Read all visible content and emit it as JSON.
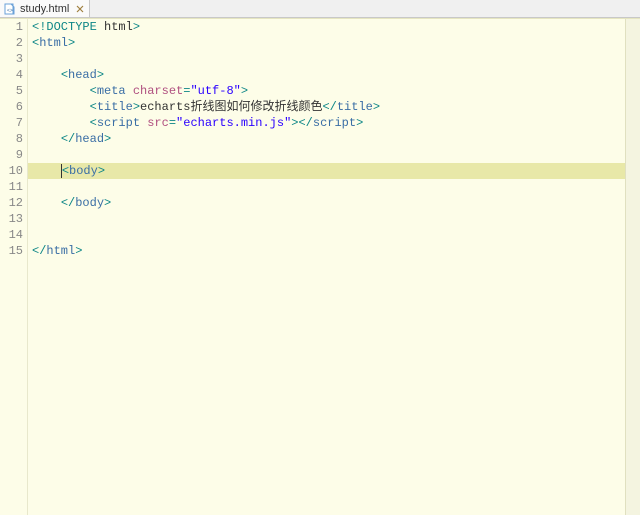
{
  "tab": {
    "filename": "study.html"
  },
  "colors": {
    "background": "#fdfde8",
    "currentLine": "#e8e8a8",
    "tag": "#3a6ea5",
    "punct": "#0d8686",
    "attrName": "#b05080",
    "attrValue": "#2a00ff"
  },
  "editor": {
    "currentLine": 10,
    "lines": [
      {
        "n": 1,
        "foldable": false,
        "indent": 0,
        "raw": "<!DOCTYPE html>",
        "tokens": [
          [
            "punct",
            "<!"
          ],
          [
            "doctype-kw",
            "DOCTYPE"
          ],
          [
            "text",
            " "
          ],
          [
            "doctype-val",
            "html"
          ],
          [
            "punct",
            ">"
          ]
        ]
      },
      {
        "n": 2,
        "foldable": true,
        "indent": 0,
        "raw": "<html>",
        "tokens": [
          [
            "punct",
            "<"
          ],
          [
            "tagname",
            "html"
          ],
          [
            "punct",
            ">"
          ]
        ]
      },
      {
        "n": 3,
        "foldable": false,
        "indent": 0,
        "raw": "",
        "tokens": []
      },
      {
        "n": 4,
        "foldable": true,
        "indent": 4,
        "raw": "<head>",
        "tokens": [
          [
            "punct",
            "<"
          ],
          [
            "tagname",
            "head"
          ],
          [
            "punct",
            ">"
          ]
        ]
      },
      {
        "n": 5,
        "foldable": false,
        "indent": 8,
        "raw": "<meta charset=\"utf-8\">",
        "tokens": [
          [
            "punct",
            "<"
          ],
          [
            "tagname",
            "meta"
          ],
          [
            "text",
            " "
          ],
          [
            "attrname",
            "charset"
          ],
          [
            "punct",
            "="
          ],
          [
            "attrval",
            "\"utf-8\""
          ],
          [
            "punct",
            ">"
          ]
        ]
      },
      {
        "n": 6,
        "foldable": false,
        "indent": 8,
        "raw": "<title>echarts折线图如何修改折线颜色</title>",
        "tokens": [
          [
            "punct",
            "<"
          ],
          [
            "tagname",
            "title"
          ],
          [
            "punct",
            ">"
          ],
          [
            "text",
            "echarts折线图如何修改折线颜色"
          ],
          [
            "punct",
            "</"
          ],
          [
            "tagname",
            "title"
          ],
          [
            "punct",
            ">"
          ]
        ]
      },
      {
        "n": 7,
        "foldable": false,
        "indent": 8,
        "raw": "<script src=\"echarts.min.js\"></script>",
        "tokens": [
          [
            "punct",
            "<"
          ],
          [
            "tagname",
            "script"
          ],
          [
            "text",
            " "
          ],
          [
            "attrname",
            "src"
          ],
          [
            "punct",
            "="
          ],
          [
            "attrval",
            "\"echarts.min.js\""
          ],
          [
            "punct",
            ">"
          ],
          [
            "punct",
            "</"
          ],
          [
            "tagname",
            "script"
          ],
          [
            "punct",
            ">"
          ]
        ]
      },
      {
        "n": 8,
        "foldable": false,
        "indent": 4,
        "raw": "</head>",
        "tokens": [
          [
            "punct",
            "</"
          ],
          [
            "tagname",
            "head"
          ],
          [
            "punct",
            ">"
          ]
        ]
      },
      {
        "n": 9,
        "foldable": false,
        "indent": 0,
        "raw": "",
        "tokens": []
      },
      {
        "n": 10,
        "foldable": true,
        "indent": 4,
        "raw": "<body>",
        "tokens": [
          [
            "punct",
            "<"
          ],
          [
            "tagname",
            "body"
          ],
          [
            "punct",
            ">"
          ]
        ]
      },
      {
        "n": 11,
        "foldable": false,
        "indent": 0,
        "raw": "",
        "tokens": []
      },
      {
        "n": 12,
        "foldable": false,
        "indent": 4,
        "raw": "</body>",
        "tokens": [
          [
            "punct",
            "</"
          ],
          [
            "tagname",
            "body"
          ],
          [
            "punct",
            ">"
          ]
        ]
      },
      {
        "n": 13,
        "foldable": false,
        "indent": 0,
        "raw": "",
        "tokens": []
      },
      {
        "n": 14,
        "foldable": false,
        "indent": 0,
        "raw": "",
        "tokens": []
      },
      {
        "n": 15,
        "foldable": false,
        "indent": 0,
        "raw": "</html>",
        "tokens": [
          [
            "punct",
            "</"
          ],
          [
            "tagname",
            "html"
          ],
          [
            "punct",
            ">"
          ]
        ]
      }
    ]
  }
}
